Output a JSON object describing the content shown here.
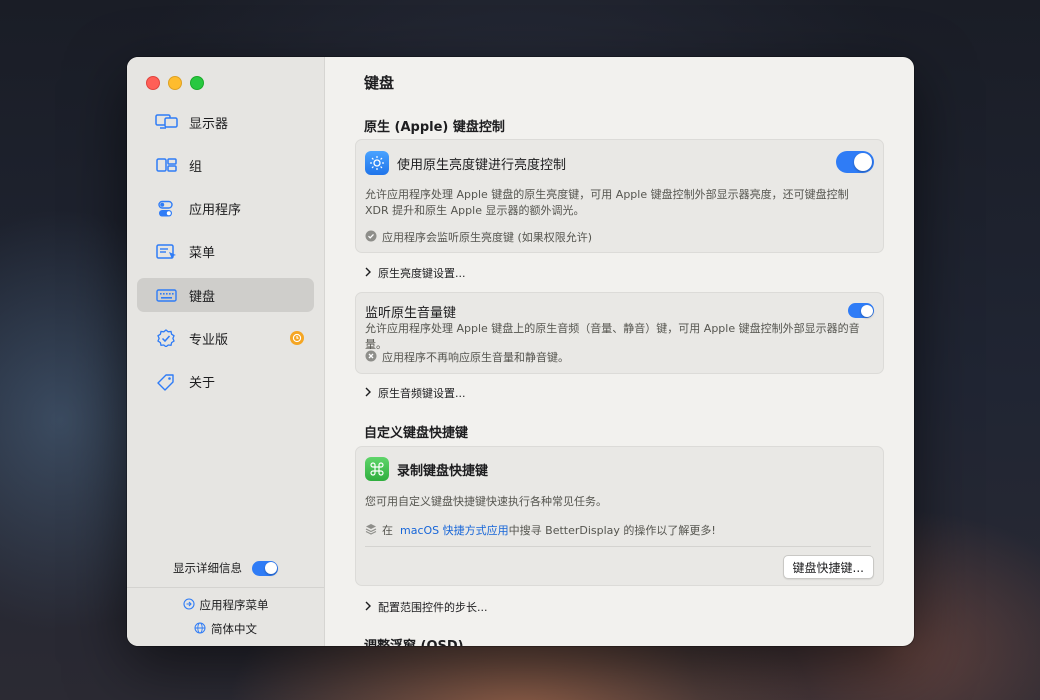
{
  "colors": {
    "accent": "#2f7cf6",
    "badge": "#f5a623",
    "link": "#1665d8"
  },
  "sidebar": {
    "items": [
      {
        "label": "显示器",
        "icon": "display-icon"
      },
      {
        "label": "组",
        "icon": "group-icon"
      },
      {
        "label": "应用程序",
        "icon": "app-toggle-icon"
      },
      {
        "label": "菜单",
        "icon": "menu-icon"
      },
      {
        "label": "键盘",
        "icon": "keyboard-icon",
        "active": true
      },
      {
        "label": "专业版",
        "icon": "badge-check-icon",
        "badge": "clock-icon"
      },
      {
        "label": "关于",
        "icon": "tag-icon"
      }
    ],
    "show_details_label": "显示详细信息",
    "show_details_on": true,
    "app_menu_label": "应用程序菜单",
    "language_label": "简体中文"
  },
  "main": {
    "title": "键盘",
    "native_section": {
      "title": "原生 (Apple) 键盘控制",
      "brightness_card": {
        "label": "使用原生亮度键进行亮度控制",
        "enabled": true,
        "description": "允许应用程序处理 Apple 键盘的原生亮度键，可用 Apple 键盘控制外部显示器亮度，还可键盘控制 XDR 提升和原生 Apple 显示器的额外调光。",
        "note": "应用程序会监听原生亮度键 (如果权限允许)"
      },
      "brightness_settings_link": "原生亮度键设置...",
      "volume_card": {
        "label": "监听原生音量键",
        "enabled": true,
        "description": "允许应用程序处理 Apple 键盘上的原生音频（音量、静音）键，可用 Apple 键盘控制外部显示器的音量。",
        "note": "应用程序不再响应原生音量和静音键。"
      },
      "volume_settings_link": "原生音频键设置..."
    },
    "custom_section": {
      "title": "自定义键盘快捷键",
      "record_card": {
        "label": "录制键盘快捷键",
        "description": "您可用自定义键盘快捷键快速执行各种常见任务。",
        "hint_prefix": "在",
        "hint_link": "macOS 快捷方式应用",
        "hint_suffix": "中搜寻 BetterDisplay 的操作以了解更多!",
        "button_label": "键盘快捷键..."
      },
      "range_steps_link": "配置范围控件的步长..."
    },
    "osd_section_title": "调整浮窗 (OSD)"
  }
}
